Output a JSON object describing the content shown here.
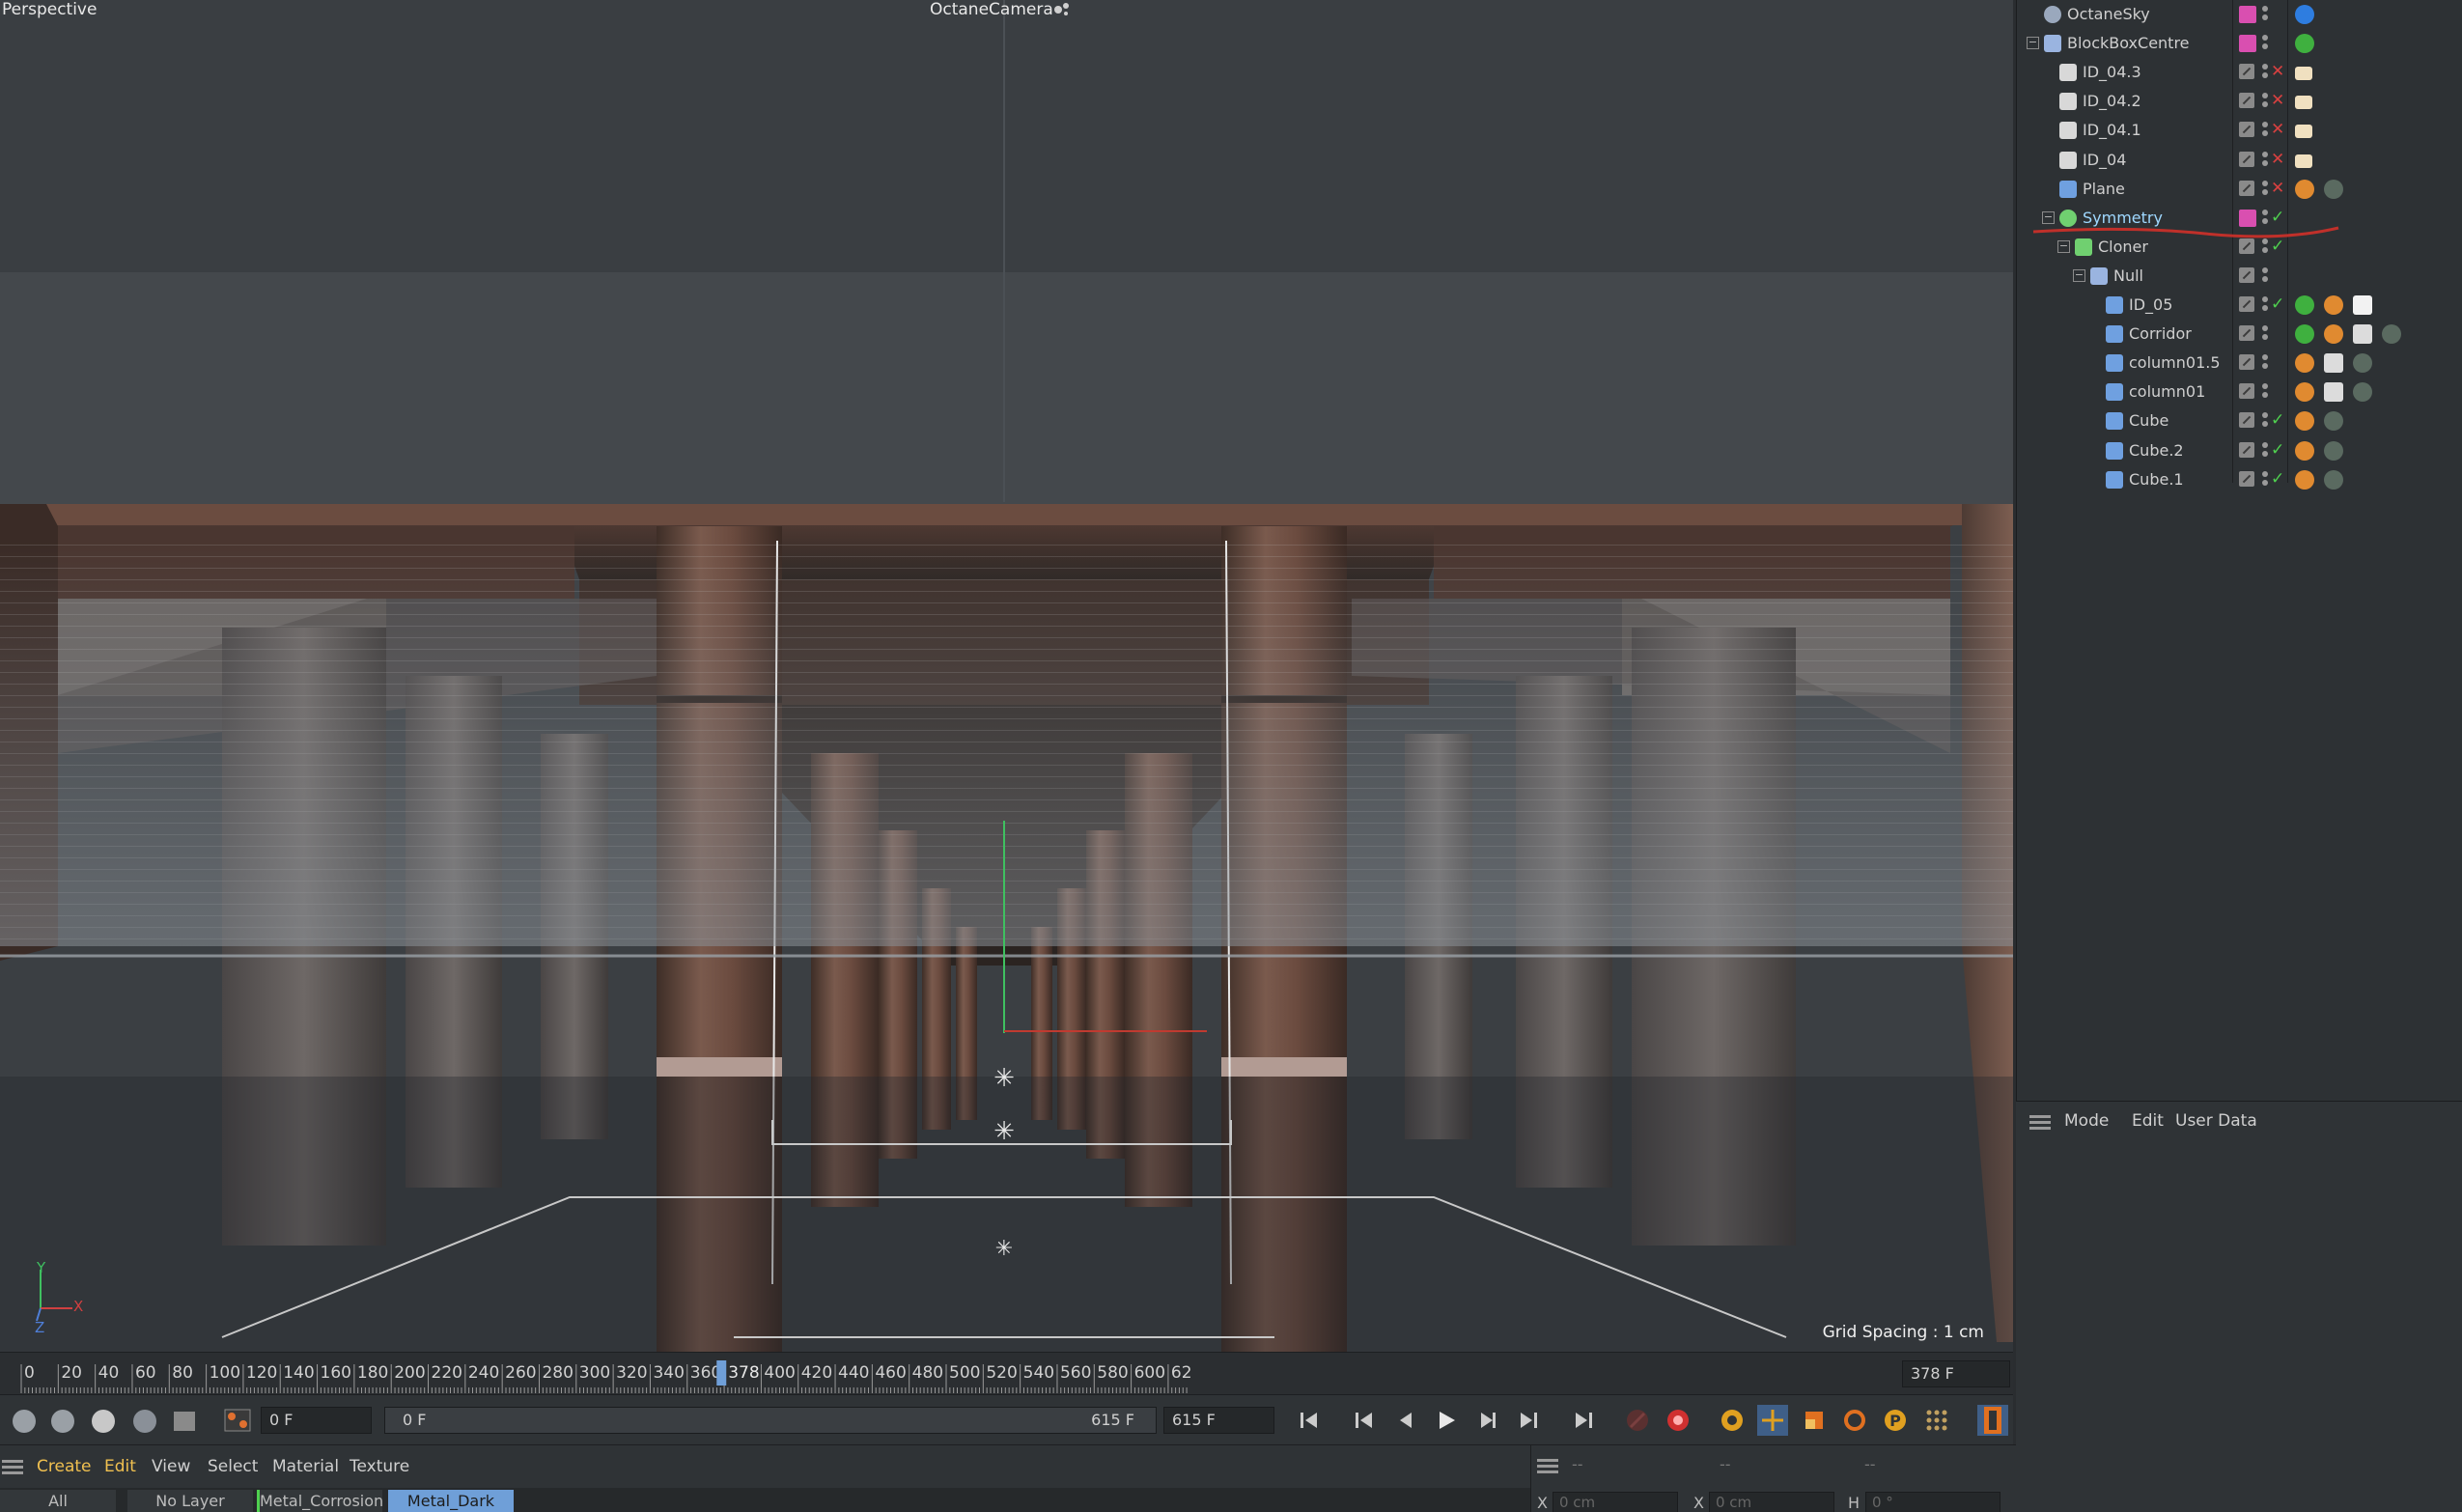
{
  "viewport": {
    "view_name": "Perspective",
    "camera_name": "OctaneCamera",
    "grid_spacing": "Grid Spacing : 1 cm",
    "axis_labels": {
      "y": "Y",
      "x": "X",
      "z": "Z"
    }
  },
  "object_manager": {
    "objects": [
      {
        "name": "OctaneSky",
        "icon": "sky-icon",
        "depth": 0,
        "expand": "",
        "layer_color": "#d94fb0",
        "status": "",
        "tags": [
          "octane-sky-tag"
        ]
      },
      {
        "name": "BlockBoxCentre",
        "icon": "null-object-icon",
        "depth": 0,
        "expand": "−",
        "layer_color": "#d94fb0",
        "status": "",
        "tags": [
          "green-material-tag"
        ]
      },
      {
        "name": "ID_04.3",
        "icon": "light-plane-icon",
        "depth": 1,
        "expand": "",
        "layer_color": "",
        "status": "cross",
        "tags": [
          "light-tag"
        ]
      },
      {
        "name": "ID_04.2",
        "icon": "light-plane-icon",
        "depth": 1,
        "expand": "",
        "layer_color": "",
        "status": "cross",
        "tags": [
          "light-tag"
        ]
      },
      {
        "name": "ID_04.1",
        "icon": "light-plane-icon",
        "depth": 1,
        "expand": "",
        "layer_color": "",
        "status": "cross",
        "tags": [
          "light-tag"
        ]
      },
      {
        "name": "ID_04",
        "icon": "light-plane-icon",
        "depth": 1,
        "expand": "",
        "layer_color": "",
        "status": "cross",
        "tags": [
          "light-tag"
        ]
      },
      {
        "name": "Plane",
        "icon": "plane-icon",
        "depth": 1,
        "expand": "",
        "layer_color": "",
        "status": "cross",
        "tags": [
          "phong-tag",
          "material-tag"
        ]
      },
      {
        "name": "Symmetry",
        "icon": "symmetry-icon",
        "depth": 1,
        "expand": "−",
        "layer_color": "#d94fb0",
        "status": "check",
        "tags": []
      },
      {
        "name": "Cloner",
        "icon": "cloner-icon",
        "depth": 2,
        "expand": "−",
        "layer_color": "",
        "status": "check",
        "tags": []
      },
      {
        "name": "Null",
        "icon": "null-object-icon",
        "depth": 3,
        "expand": "−",
        "layer_color": "",
        "status": "",
        "tags": []
      },
      {
        "name": "ID_05",
        "icon": "polygon-object-icon",
        "depth": 4,
        "expand": "",
        "layer_color": "",
        "status": "check",
        "tags": [
          "green-material-tag",
          "phong-tag",
          "white-material-tag"
        ]
      },
      {
        "name": "Corridor",
        "icon": "polygon-object-icon",
        "depth": 4,
        "expand": "",
        "layer_color": "",
        "status": "",
        "tags": [
          "green-material-tag",
          "phong-tag",
          "checker-material-tag",
          "material-tag"
        ]
      },
      {
        "name": "column01.5",
        "icon": "polygon-object-icon",
        "depth": 4,
        "expand": "",
        "layer_color": "",
        "status": "",
        "tags": [
          "phong-tag",
          "checker-material-tag",
          "material-tag"
        ]
      },
      {
        "name": "column01",
        "icon": "polygon-object-icon",
        "depth": 4,
        "expand": "",
        "layer_color": "",
        "status": "",
        "tags": [
          "phong-tag",
          "checker-material-tag",
          "material-tag"
        ]
      },
      {
        "name": "Cube",
        "icon": "cube-icon",
        "depth": 4,
        "expand": "",
        "layer_color": "",
        "status": "check",
        "tags": [
          "phong-tag",
          "material-tag"
        ]
      },
      {
        "name": "Cube.2",
        "icon": "cube-icon",
        "depth": 4,
        "expand": "",
        "layer_color": "",
        "status": "check",
        "tags": [
          "phong-tag",
          "material-tag"
        ]
      },
      {
        "name": "Cube.1",
        "icon": "cube-icon",
        "depth": 4,
        "expand": "",
        "layer_color": "",
        "status": "check",
        "tags": [
          "phong-tag",
          "material-tag"
        ]
      }
    ]
  },
  "attribute_manager": {
    "menu": [
      "Mode",
      "Edit",
      "User Data"
    ]
  },
  "timeline": {
    "ticks": [
      "0",
      "20",
      "40",
      "60",
      "80",
      "100",
      "120",
      "140",
      "160",
      "180",
      "200",
      "220",
      "240",
      "260",
      "280",
      "300",
      "320",
      "340",
      "360",
      "400",
      "420",
      "440",
      "460",
      "480",
      "500",
      "520",
      "540",
      "560",
      "580",
      "600",
      "62"
    ],
    "current_frame_marker": "378",
    "current_frame_field": "378 F"
  },
  "transport": {
    "start_field": "0 F",
    "range_start": "0 F",
    "range_end": "615 F",
    "end_field": "615 F"
  },
  "material_manager": {
    "menu": [
      "Create",
      "Edit",
      "View",
      "Select",
      "Material",
      "Texture"
    ],
    "tabs": [
      "All",
      "No Layer",
      "Metal_Corrosion",
      "Metal_Dark"
    ],
    "active_tab": "Metal_Dark"
  },
  "coordinates": {
    "headers": [
      "--",
      "--",
      "--"
    ],
    "fields": [
      {
        "label": "X",
        "value": "0 cm"
      },
      {
        "label": "X",
        "value": "0 cm"
      },
      {
        "label": "H",
        "value": "0 °"
      }
    ]
  },
  "colors": {
    "accent_blue": "#6f9fd8",
    "layer_pink": "#d94fb0",
    "status_red": "#d94040",
    "status_green": "#4fd04f",
    "menu_active": "#f0c050",
    "annotation_red": "#c0302a"
  }
}
